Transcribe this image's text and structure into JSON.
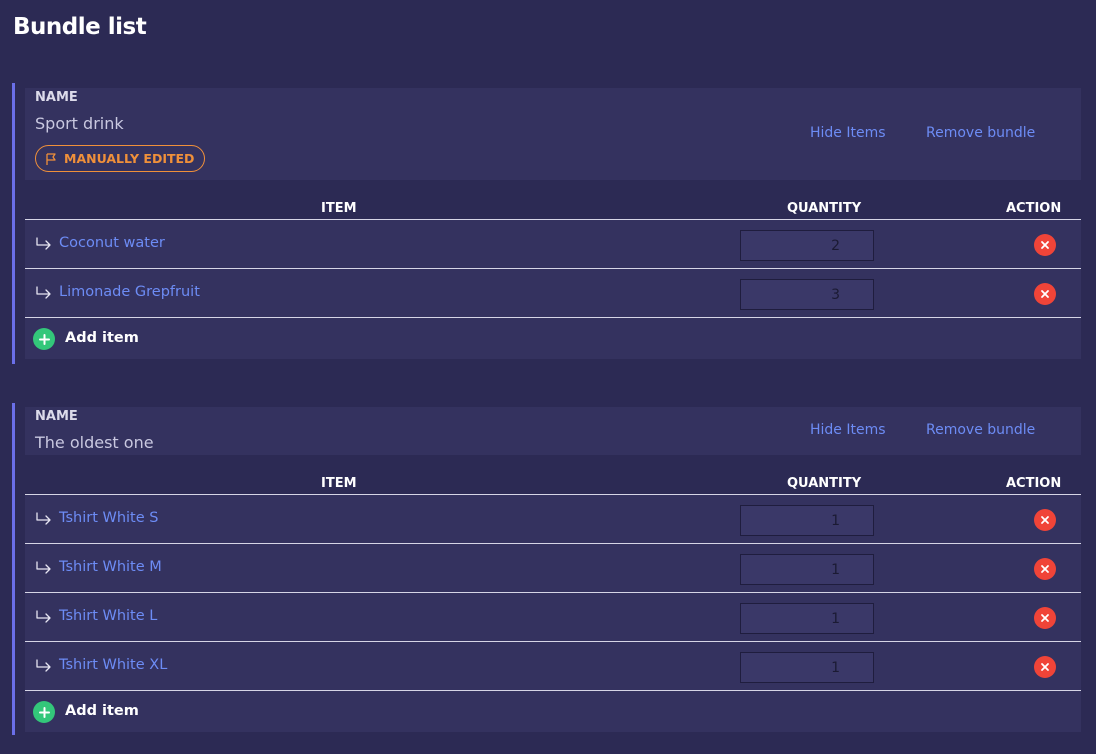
{
  "page": {
    "title": "Bundle list"
  },
  "columns": {
    "item": "ITEM",
    "quantity": "QUANTITY",
    "action": "ACTION"
  },
  "colors": {
    "link": "#6d8cf5",
    "badge": "#f0903a",
    "remove": "#f04438",
    "add": "#33c77a",
    "accent": "#6b6fe8"
  },
  "bundles": [
    {
      "name_label": "NAME",
      "name": "Sport drink",
      "badge": "MANUALLY EDITED",
      "hide_items": "Hide Items",
      "remove_bundle": "Remove bundle",
      "items": [
        {
          "name": "Coconut water",
          "quantity": "2"
        },
        {
          "name": "Limonade Grepfruit",
          "quantity": "3"
        }
      ],
      "add_item": "Add item"
    },
    {
      "name_label": "NAME",
      "name": "The oldest one",
      "hide_items": "Hide Items",
      "remove_bundle": "Remove bundle",
      "items": [
        {
          "name": "Tshirt White S",
          "quantity": "1"
        },
        {
          "name": "Tshirt White M",
          "quantity": "1"
        },
        {
          "name": "Tshirt White L",
          "quantity": "1"
        },
        {
          "name": "Tshirt White XL",
          "quantity": "1"
        }
      ],
      "add_item": "Add item"
    }
  ]
}
